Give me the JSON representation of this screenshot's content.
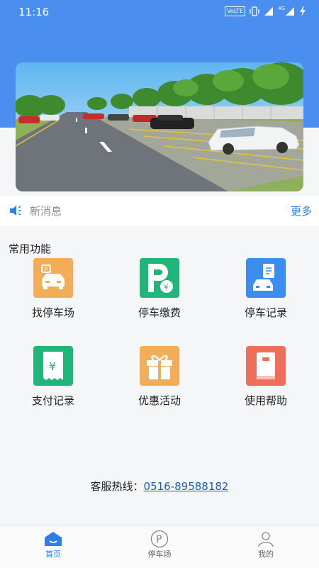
{
  "status_bar": {
    "time": "11:16",
    "volte": "VoLTE",
    "network": "4G"
  },
  "news": {
    "label": "新消息",
    "more": "更多"
  },
  "functions": {
    "title": "常用功能",
    "items": [
      {
        "label": "找停车场",
        "color": "#f3ad56"
      },
      {
        "label": "停车缴费",
        "color": "#21b57a"
      },
      {
        "label": "停车记录",
        "color": "#3b8df0"
      },
      {
        "label": "支付记录",
        "color": "#21b57a"
      },
      {
        "label": "优惠活动",
        "color": "#f3ad56"
      },
      {
        "label": "使用帮助",
        "color": "#ef6d5b"
      }
    ]
  },
  "hotline": {
    "label": "客服热线：",
    "number": "0516-89588182"
  },
  "tabbar": {
    "items": [
      {
        "label": "首页",
        "icon": "home-icon",
        "active": true
      },
      {
        "label": "停车场",
        "icon": "parking-icon",
        "active": false
      },
      {
        "label": "我的",
        "icon": "profile-icon",
        "active": false
      }
    ]
  },
  "colors": {
    "primary": "#4a8ef0",
    "accent_text": "#2f7ee8"
  }
}
